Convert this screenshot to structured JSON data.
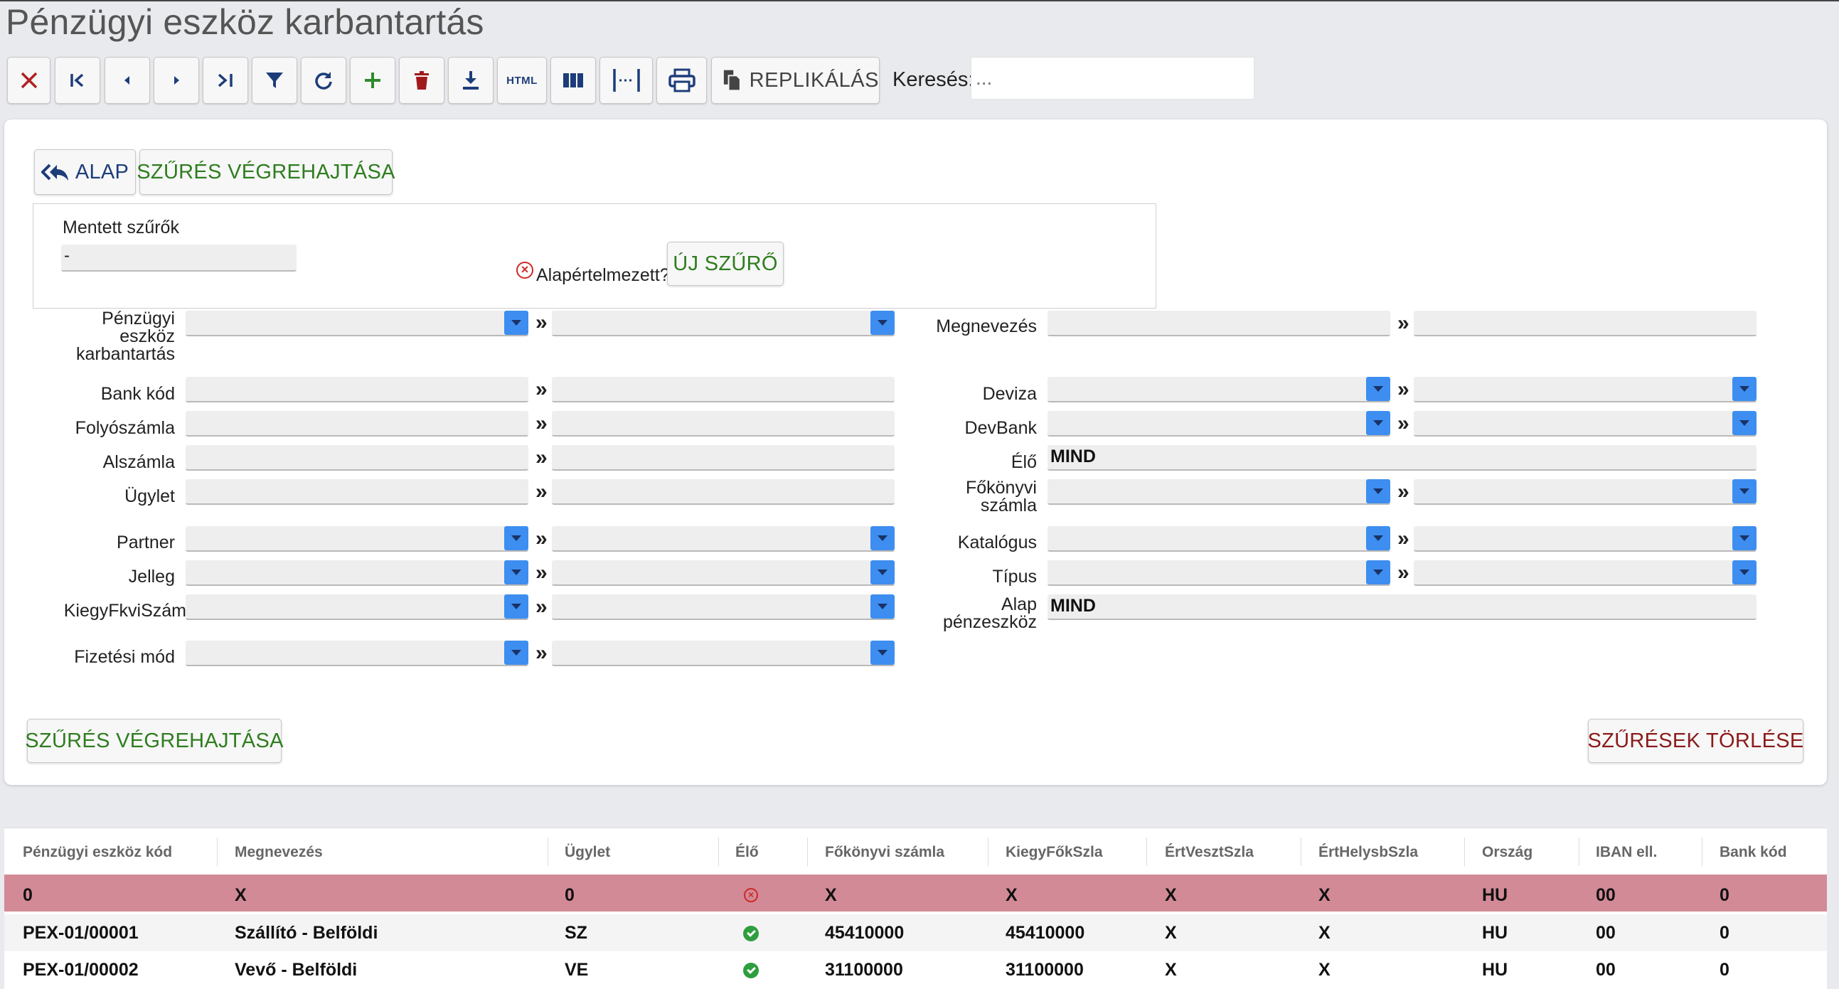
{
  "title": "Pénzügyi eszköz karbantartás",
  "toolbar": {
    "html_label": "HTML",
    "replicate_label": "REPLIKÁLÁS",
    "search_label": "Keresés:",
    "search_placeholder": "..."
  },
  "filter_panel": {
    "base_label": "ALAP",
    "run_filter_top": "SZŰRÉS VÉGREHAJTÁSA",
    "saved_filters_label": "Mentett szűrők",
    "saved_filters_value": "-",
    "default_question": "Alapértelmezett?",
    "new_filter_label": "ÚJ SZŰRŐ",
    "run_filter_bottom": "SZŰRÉS VÉGREHAJTÁSA",
    "clear_filters": "SZŰRÉSEK TÖRLÉSE",
    "left_fields": {
      "asset": "Pénzügyi eszköz karbantartás",
      "bank_code": "Bank kód",
      "account": "Folyószámla",
      "subaccount": "Alszámla",
      "transaction": "Ügylet",
      "partner": "Partner",
      "nature": "Jelleg",
      "supp_gl": "KiegyFkviSzám",
      "payment": "Fizetési mód"
    },
    "right_fields": {
      "name": "Megnevezés",
      "currency": "Deviza",
      "devbank": "DevBank",
      "live": "Élő",
      "live_value": "MIND",
      "gl_account": "Főkönyvi számla",
      "catalog": "Katalógus",
      "type": "Típus",
      "base_asset": "Alap pénzeszköz",
      "base_asset_value": "MIND"
    },
    "range_sep": "»"
  },
  "table": {
    "columns": [
      "Pénzügyi eszköz kód",
      "Megnevezés",
      "Ügylet",
      "Élő",
      "Főkönyvi számla",
      "KiegyFőkSzla",
      "ÉrtVesztSzla",
      "ÉrtHelysbSzla",
      "Ország",
      "IBAN ell.",
      "Bank kód"
    ],
    "rows": [
      {
        "code": "0",
        "name": "X",
        "trans": "0",
        "live": "no",
        "gl": "X",
        "supp": "X",
        "loss": "X",
        "rev": "X",
        "country": "HU",
        "iban": "00",
        "bank": "0"
      },
      {
        "code": "PEX-01/00001",
        "name": "Szállító - Belföldi",
        "trans": "SZ",
        "live": "yes",
        "gl": "45410000",
        "supp": "45410000",
        "loss": "X",
        "rev": "X",
        "country": "HU",
        "iban": "00",
        "bank": "0"
      },
      {
        "code": "PEX-01/00002",
        "name": "Vevő - Belföldi",
        "trans": "VE",
        "live": "yes",
        "gl": "31100000",
        "supp": "31100000",
        "loss": "X",
        "rev": "X",
        "country": "HU",
        "iban": "00",
        "bank": "0"
      }
    ]
  },
  "colors": {
    "accent": "#1d3d7a",
    "green": "#2e7d1e",
    "danger": "#8b1a1a",
    "selected_row": "#d28a96",
    "dropdown": "#3d8ef0"
  }
}
